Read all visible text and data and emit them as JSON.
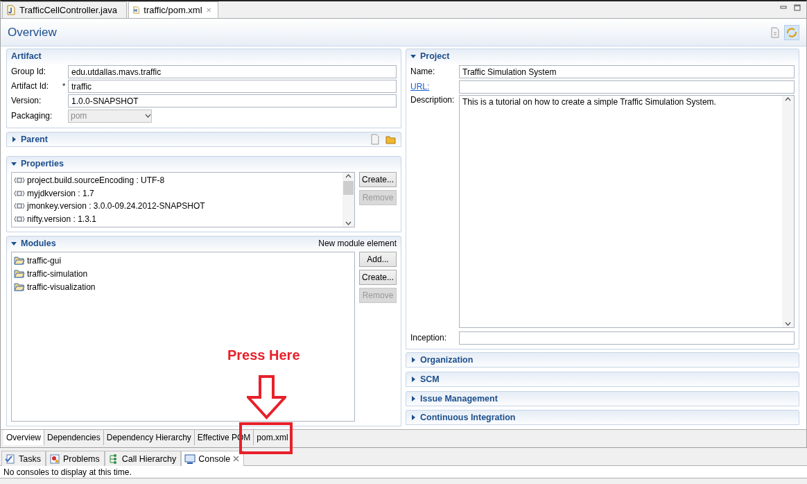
{
  "editor_tabs": [
    {
      "label": "TrafficCellController.java",
      "selected": false
    },
    {
      "label": "traffic/pom.xml",
      "selected": true
    }
  ],
  "page_title": "Overview",
  "artifact": {
    "title": "Artifact",
    "fields": [
      {
        "kind": "text",
        "label": "Group Id:",
        "value": "edu.utdallas.mavs.traffic"
      },
      {
        "kind": "text",
        "label": "Artifact Id:",
        "value": "traffic",
        "required_mark": "*"
      },
      {
        "kind": "text",
        "label": "Version:",
        "value": "1.0.0-SNAPSHOT"
      },
      {
        "kind": "combo",
        "label": "Packaging:",
        "value": "pom",
        "disabled": true
      }
    ]
  },
  "parent": {
    "title": "Parent",
    "expanded": false
  },
  "properties": {
    "title": "Properties",
    "expanded": true,
    "items": [
      "project.build.sourceEncoding : UTF-8",
      "myjdkversion : 1.7",
      "jmonkey.version : 3.0.0-09.24.2012-SNAPSHOT",
      "nifty.version : 1.3.1"
    ],
    "buttons": [
      {
        "label": "Create...",
        "disabled": false
      },
      {
        "label": "Remove",
        "disabled": true
      }
    ]
  },
  "modules": {
    "title": "Modules",
    "expanded": true,
    "action": "New module element",
    "items": [
      "traffic-gui",
      "traffic-simulation",
      "traffic-visualization"
    ],
    "buttons": [
      {
        "label": "Add...",
        "disabled": false
      },
      {
        "label": "Create...",
        "disabled": false
      },
      {
        "label": "Remove",
        "disabled": true
      }
    ]
  },
  "project": {
    "title": "Project",
    "expanded": true,
    "fields": [
      {
        "kind": "text",
        "label": "Name:",
        "value": "Traffic Simulation System"
      },
      {
        "kind": "link",
        "label": "URL:"
      },
      {
        "kind": "textarea",
        "label": "Description:",
        "value": "This is a tutorial on how to create a simple Traffic Simulation System."
      },
      {
        "kind": "text",
        "label": "Inception:"
      }
    ]
  },
  "collapsed_sections": [
    {
      "title": "Organization",
      "expanded": false
    },
    {
      "title": "SCM",
      "expanded": false
    },
    {
      "title": "Issue Management",
      "expanded": false
    },
    {
      "title": "Continuous Integration",
      "expanded": false
    }
  ],
  "page_tabs": [
    {
      "label": "Overview",
      "selected": true
    },
    {
      "label": "Dependencies",
      "selected": false
    },
    {
      "label": "Dependency Hierarchy",
      "selected": false
    },
    {
      "label": "Effective POM",
      "selected": false
    },
    {
      "label": "pom.xml",
      "selected": false
    }
  ],
  "view_tabs": [
    {
      "label": "Tasks",
      "selected": false
    },
    {
      "label": "Problems",
      "selected": false
    },
    {
      "label": "Call Hierarchy",
      "selected": false
    },
    {
      "label": "Console",
      "selected": true
    }
  ],
  "console_message": "No consoles to display at this time.",
  "annotation": {
    "text": "Press Here"
  }
}
